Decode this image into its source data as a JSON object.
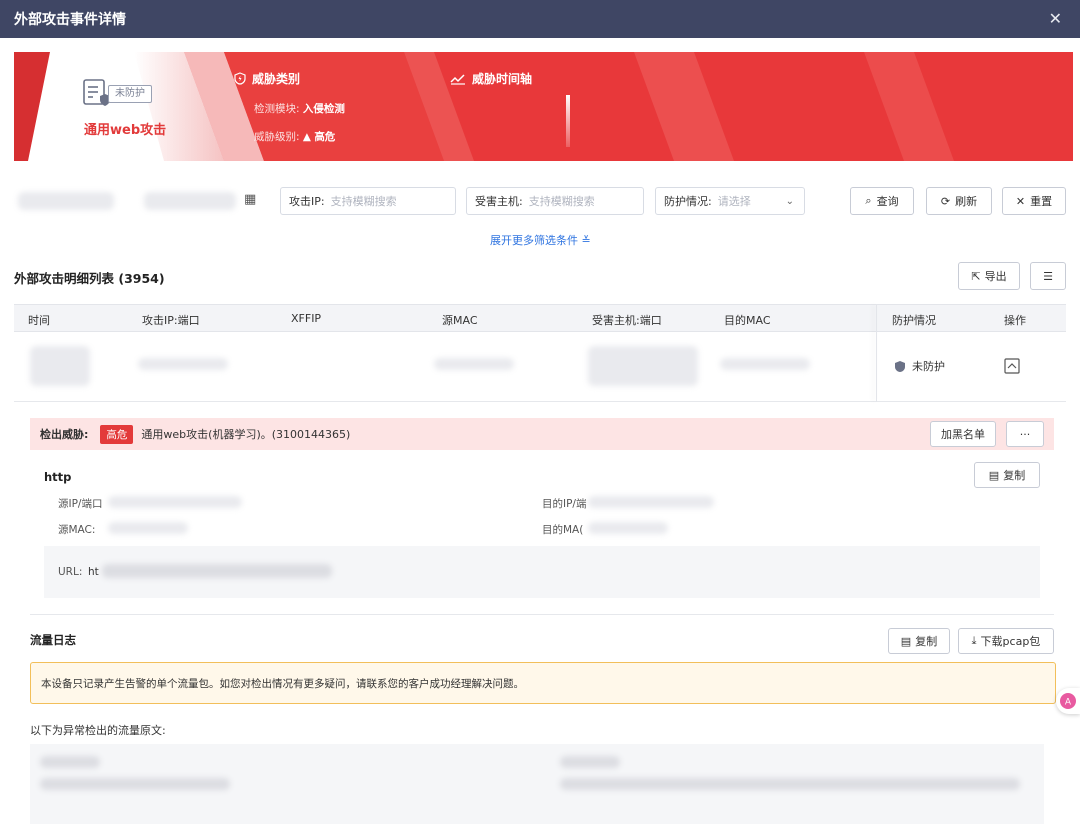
{
  "window": {
    "title": "外部攻击事件详情"
  },
  "banner": {
    "protection_tag": "未防护",
    "attack_name": "通用web攻击",
    "category_title": "威胁类别",
    "module_key": "检测模块:",
    "module_value": "入侵检测",
    "level_key": "威胁级别:",
    "level_value": "高危",
    "timeline_title": "威胁时间轴",
    "colors": {
      "banner": "#e8383a",
      "accent": "#e23a3a"
    }
  },
  "filters": {
    "attack_ip_label": "攻击IP:",
    "attack_ip_placeholder": "支持模糊搜索",
    "victim_label": "受害主机:",
    "victim_placeholder": "支持模糊搜索",
    "protection_label": "防护情况:",
    "protection_placeholder": "请选择",
    "query_label": "查询",
    "refresh_label": "刷新",
    "reset_label": "重置",
    "expand_label": "展开更多筛选条件"
  },
  "list": {
    "title": "外部攻击明细列表 (3954)",
    "export_label": "导出",
    "columns": [
      "时间",
      "攻击IP:端口",
      "XFFIP",
      "源MAC",
      "受害主机:端口",
      "目的MAC",
      "防护情况",
      "操作"
    ],
    "rows": [
      {
        "protection": "未防护"
      }
    ]
  },
  "detail": {
    "threat_key": "检出威胁:",
    "threat_level": "高危",
    "threat_desc": "通用web攻击(机器学习)。(3100144365)",
    "blacklist_label": "加黑名单",
    "more_label": "···",
    "protocol": "http",
    "copy_label": "复制",
    "src_ip_key": "源IP/端口",
    "dst_ip_key": "目的IP/端",
    "src_mac_key": "源MAC:",
    "dst_mac_key": "目的MA(",
    "url_key": "URL:",
    "url_value": "ht",
    "flow_title": "流量日志",
    "flow_copy_label": "复制",
    "download_label": "下载pcap包",
    "notice": "本设备只记录产生告警的单个流量包。如您对检出情况有更多疑问，请联系您的客户成功经理解决问题。",
    "raw_label": "以下为异常检出的流量原文:"
  }
}
